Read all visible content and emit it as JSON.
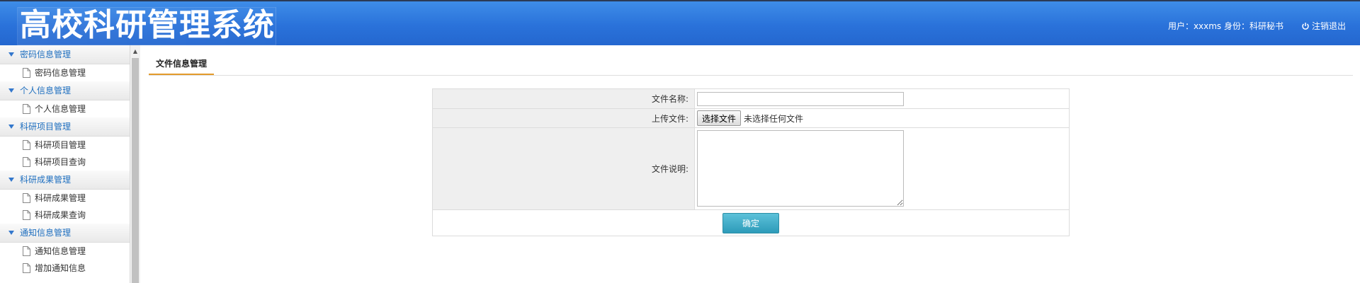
{
  "header": {
    "title": "高校科研管理系统",
    "user_info": "用户：xxxms 身份：科研秘书",
    "logout_label": "注销退出"
  },
  "sidebar": {
    "groups": [
      {
        "label": "密码信息管理",
        "items": [
          "密码信息管理"
        ]
      },
      {
        "label": "个人信息管理",
        "items": [
          "个人信息管理"
        ]
      },
      {
        "label": "科研项目管理",
        "items": [
          "科研项目管理",
          "科研项目查询"
        ]
      },
      {
        "label": "科研成果管理",
        "items": [
          "科研成果管理",
          "科研成果查询"
        ]
      },
      {
        "label": "通知信息管理",
        "items": [
          "通知信息管理",
          "增加通知信息"
        ]
      }
    ]
  },
  "main": {
    "tab_label": "文件信息管理",
    "form": {
      "file_name_label": "文件名称:",
      "file_name_value": "",
      "upload_label": "上传文件:",
      "choose_file_button": "选择文件",
      "no_file_text": "未选择任何文件",
      "description_label": "文件说明:",
      "description_value": "",
      "submit_label": "确定"
    }
  },
  "colors": {
    "header_blue": "#2a72da",
    "sidebar_link": "#1f6fbf",
    "tab_underline": "#e39a2a",
    "submit_button": "#2d9bb9"
  },
  "icons": {
    "group_toggle": "triangle-down-icon",
    "menu_item": "document-icon",
    "logout": "power-icon",
    "scroll_up": "arrow-up-icon"
  }
}
